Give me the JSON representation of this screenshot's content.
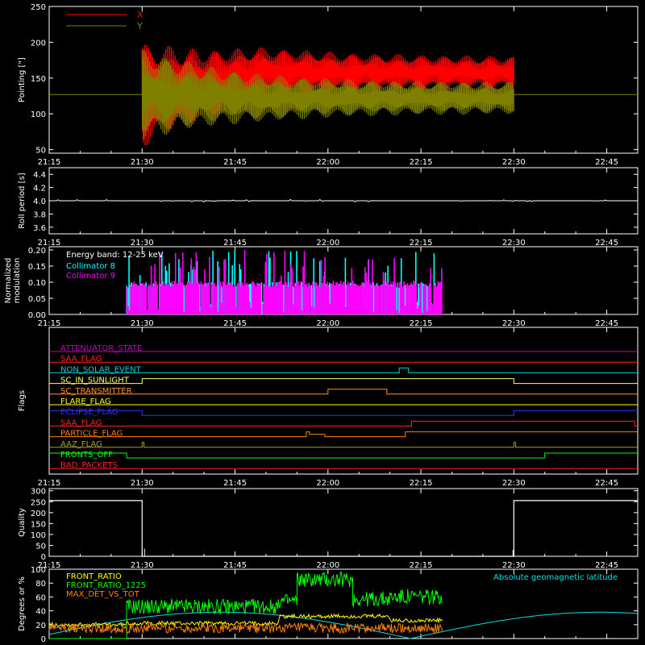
{
  "chart_data": [
    {
      "id": "pointing",
      "type": "line",
      "ylabel": "Pointing [\"]",
      "ylim": [
        45,
        250
      ],
      "yticks": [
        50,
        100,
        150,
        200,
        250
      ],
      "xticks": [
        "21:15",
        "21:30",
        "21:45",
        "22:00",
        "22:15",
        "22:30",
        "22:45"
      ],
      "x_range_min": [
        0,
        95
      ],
      "legend_position": "top-left",
      "series": [
        {
          "name": "X",
          "color": "#ff0000",
          "baseline": 127,
          "active_min": [
            15,
            75
          ],
          "start_amplitude": 75,
          "end_center": 158,
          "end_amplitude": 22
        },
        {
          "name": "Y",
          "color": "#808000",
          "baseline": 127,
          "active_min": [
            15,
            75
          ],
          "start_amplitude": 65,
          "end_center": 122,
          "end_amplitude": 22
        }
      ]
    },
    {
      "id": "roll_period",
      "type": "line",
      "ylabel": "Roll period [s]",
      "ylim": [
        3.5,
        4.5
      ],
      "yticks": [
        "3.6",
        "3.8",
        "4.0",
        "4.2",
        "4.4"
      ],
      "xticks": [
        "21:15",
        "21:30",
        "21:45",
        "22:00",
        "22:15",
        "22:30",
        "22:45"
      ],
      "x_range_min": [
        0,
        95
      ],
      "series": [
        {
          "name": "",
          "color": "#ffffff",
          "value": 4.0
        }
      ]
    },
    {
      "id": "modulation",
      "type": "bar",
      "ylabel": "Normalized modulation",
      "ylim": [
        0,
        0.21
      ],
      "yticks": [
        "0.00",
        "0.05",
        "0.10",
        "0.15",
        "0.20"
      ],
      "xticks": [
        "21:15",
        "21:30",
        "21:45",
        "22:00",
        "22:15",
        "22:30",
        "22:45"
      ],
      "x_range_min": [
        0,
        95
      ],
      "annotation": "Energy band: 12-25 keV",
      "active_min": [
        12.5,
        63.5
      ],
      "series": [
        {
          "name": "Collimator 8",
          "color": "#00ffff",
          "typical": 0.09
        },
        {
          "name": "Collimator 9",
          "color": "#ff00ff",
          "typical": 0.095
        }
      ]
    },
    {
      "id": "flags",
      "type": "line",
      "ylabel": "Flags",
      "x_range_min": [
        0,
        95
      ],
      "xticks": [
        "21:15",
        "21:30",
        "21:45",
        "22:00",
        "22:15",
        "22:30",
        "22:45"
      ],
      "series": [
        {
          "name": "ATTENUATOR_STATE",
          "color": "#c000c0",
          "steps": [
            [
              0,
              0
            ]
          ]
        },
        {
          "name": "SAA_FLAG",
          "color": "#ff2020",
          "steps": [
            [
              0,
              0
            ]
          ]
        },
        {
          "name": "NON_SOLAR_EVENT",
          "color": "#00d0d0",
          "steps": [
            [
              0,
              0
            ],
            [
              56.5,
              1
            ],
            [
              58,
              0
            ]
          ]
        },
        {
          "name": "SC_IN_SUNLIGHT",
          "color": "#ffff60",
          "steps": [
            [
              0,
              0
            ],
            [
              15,
              1
            ],
            [
              75,
              0
            ]
          ]
        },
        {
          "name": "SC_TRANSMITTER",
          "color": "#ff9030",
          "steps": [
            [
              0,
              0
            ],
            [
              45,
              1
            ],
            [
              54.5,
              0
            ]
          ]
        },
        {
          "name": "FLARE_FLAG",
          "color": "#ffff00",
          "steps": [
            [
              0,
              0
            ]
          ]
        },
        {
          "name": "ECLIPSE_FLAG",
          "color": "#3030ff",
          "steps": [
            [
              0,
              1
            ],
            [
              15,
              0
            ],
            [
              75,
              1
            ]
          ]
        },
        {
          "name": "SAA_FLAG",
          "color": "#ff2020",
          "steps": [
            [
              0,
              0
            ],
            [
              58.5,
              1
            ],
            [
              94.5,
              0
            ]
          ]
        },
        {
          "name": "PARTICLE_FLAG",
          "color": "#ff8000",
          "steps": [
            [
              0,
              0
            ],
            [
              41.5,
              1
            ],
            [
              42,
              0.5
            ],
            [
              44.5,
              0
            ],
            [
              57.5,
              1
            ]
          ]
        },
        {
          "name": "AAZ_FLAG",
          "color": "#a0a030",
          "steps": [
            [
              0,
              0
            ],
            [
              15,
              1
            ],
            [
              15.3,
              0
            ],
            [
              75,
              1
            ],
            [
              75.3,
              0
            ]
          ]
        },
        {
          "name": "FRONTS_OFF",
          "color": "#00ff00",
          "steps": [
            [
              0,
              1
            ],
            [
              12.5,
              0
            ],
            [
              80,
              1
            ]
          ]
        },
        {
          "name": "BAD_PACKETS",
          "color": "#ff2020",
          "steps": [
            [
              0,
              0
            ]
          ]
        }
      ]
    },
    {
      "id": "quality",
      "type": "line",
      "ylabel": "Quality",
      "ylim": [
        0,
        310
      ],
      "yticks": [
        0,
        50,
        100,
        150,
        200,
        250,
        300
      ],
      "xticks": [
        "21:15",
        "21:30",
        "21:45",
        "22:00",
        "22:15",
        "22:30",
        "22:45"
      ],
      "x_range_min": [
        0,
        95
      ],
      "series": [
        {
          "name": "",
          "color": "#ffffff",
          "high": 255,
          "low": 0,
          "low_min": [
            15,
            75
          ]
        }
      ]
    },
    {
      "id": "ratios",
      "type": "line",
      "ylabel": "Degrees or %",
      "ylim": [
        0,
        100
      ],
      "yticks": [
        0,
        20,
        40,
        60,
        80,
        100
      ],
      "x_range_min": [
        0,
        95
      ],
      "series": [
        {
          "name": "FRONT_RATIO",
          "color": "#ffff00"
        },
        {
          "name": "FRONT_RATIO_1225",
          "color": "#00ff00",
          "levels": [
            [
              0,
              12.5,
              0
            ],
            [
              12.5,
              37,
              46
            ],
            [
              37,
              40,
              54
            ],
            [
              40,
              49,
              85
            ],
            [
              49,
              55,
              57
            ],
            [
              55,
              63.5,
              60
            ]
          ]
        },
        {
          "name": "MAX_DET_VS_TOT",
          "color": "#ff8000",
          "typical": 15
        },
        {
          "name": "Absolute geomagnetic latitude",
          "color": "#00e0e0"
        }
      ]
    }
  ]
}
